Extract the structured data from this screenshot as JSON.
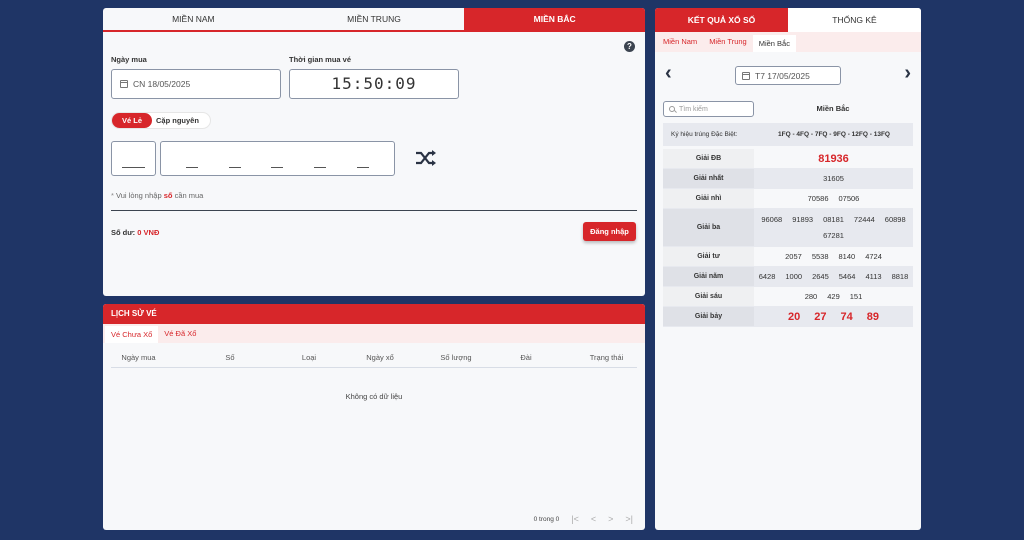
{
  "buy": {
    "region_tabs": [
      {
        "label": "MIỀN NAM",
        "active": false
      },
      {
        "label": "MIỀN TRUNG",
        "active": false
      },
      {
        "label": "MIỀN BẮC",
        "active": true
      }
    ],
    "help_glyph": "?",
    "purchase_date_label": "Ngày mua",
    "purchase_date_value": "CN 18/05/2025",
    "purchase_time_label": "Thời gian mua vé",
    "purchase_time_value": "15:50:09",
    "ticket_types": [
      {
        "label": "Vé Lẻ",
        "active": true
      },
      {
        "label": "Cặp nguyên",
        "active": false
      }
    ],
    "hint_prefix": "Vui lòng nhập",
    "hint_highlight": "số",
    "hint_suffix": "cần mua",
    "balance_label": "Số dư:",
    "balance_value": "0 VNĐ",
    "login_label": "Đăng nhập"
  },
  "history": {
    "title": "LỊCH SỬ VÉ",
    "tabs": [
      {
        "label": "Vé Chưa Xổ",
        "active": true
      },
      {
        "label": "Vé Đã Xổ",
        "active": false
      }
    ],
    "columns": [
      "Ngày mua",
      "Số",
      "Loại",
      "Ngày xổ",
      "Số lượng",
      "Đài",
      "Trạng thái"
    ],
    "empty_text": "Không có dữ liệu",
    "pager_text": "0 trong 0",
    "pager_first": "|<",
    "pager_prev": "<",
    "pager_next": ">",
    "pager_last": ">|"
  },
  "results": {
    "tabs": [
      {
        "label": "KẾT QUẢ XỔ SỐ",
        "active": true
      },
      {
        "label": "THỐNG KÊ",
        "active": false
      }
    ],
    "region_tabs": [
      {
        "label": "Miền Nam",
        "active": false
      },
      {
        "label": "Miền Trung",
        "active": false
      },
      {
        "label": "Miền Bắc",
        "active": true
      }
    ],
    "prev_arrow": "‹",
    "next_arrow": "›",
    "date_value": "T7 17/05/2025",
    "search_placeholder": "Tìm kiếm",
    "region_title": "Miền Bắc",
    "special_label": "Ký hiệu trúng Đặc Biệt:",
    "special_value": "1FQ - 4FQ - 7FQ - 9FQ - 12FQ - 13FQ",
    "prizes": [
      {
        "name": "Giải ĐB",
        "numbers": [
          "81936"
        ]
      },
      {
        "name": "Giải nhất",
        "numbers": [
          "31605"
        ]
      },
      {
        "name": "Giải nhì",
        "numbers": [
          "70586",
          "07506"
        ]
      },
      {
        "name": "Giải ba",
        "numbers": [
          "96068",
          "91893",
          "08181",
          "72444",
          "60898",
          "67281"
        ]
      },
      {
        "name": "Giải tư",
        "numbers": [
          "2057",
          "5538",
          "8140",
          "4724"
        ]
      },
      {
        "name": "Giải năm",
        "numbers": [
          "6428",
          "1000",
          "2645",
          "5464",
          "4113",
          "8818"
        ]
      },
      {
        "name": "Giải sáu",
        "numbers": [
          "280",
          "429",
          "151"
        ]
      },
      {
        "name": "Giải bảy",
        "numbers": [
          "20",
          "27",
          "74",
          "89"
        ]
      }
    ]
  }
}
